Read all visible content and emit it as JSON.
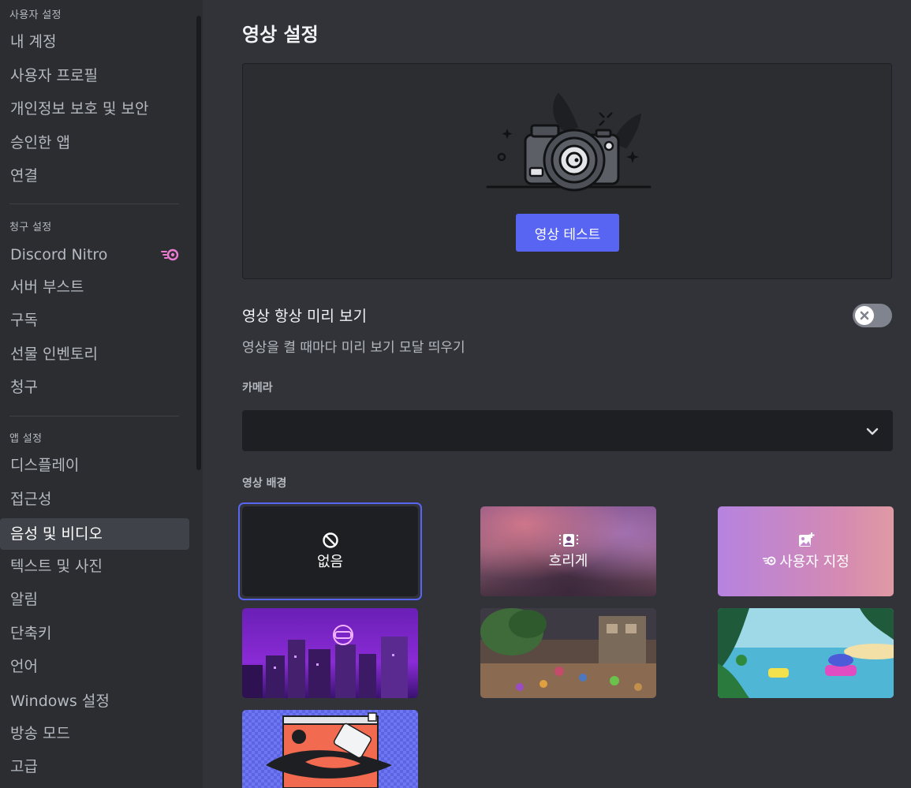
{
  "sidebar": {
    "user_settings_header": "사용자 설정",
    "user_items": [
      "내 계정",
      "사용자 프로필",
      "개인정보 보호 및 보안",
      "승인한 앱",
      "연결"
    ],
    "billing_header": "청구 설정",
    "billing_items": [
      "Discord Nitro",
      "서버 부스트",
      "구독",
      "선물 인벤토리",
      "청구"
    ],
    "app_header": "앱 설정",
    "app_items": [
      "디스플레이",
      "접근성",
      "음성 및 비디오",
      "텍스트 및 사진",
      "알림",
      "단축키",
      "언어",
      "Windows 설정",
      "방송 모드",
      "고급"
    ],
    "active_item": "음성 및 비디오"
  },
  "main": {
    "title": "영상 설정",
    "test_button": "영상 테스트",
    "always_preview": {
      "title": "영상 항상 미리 보기",
      "description": "영상을 켤 때마다 미리 보기 모달 띄우기",
      "enabled": false
    },
    "camera": {
      "label": "카메라",
      "value": ""
    },
    "backgrounds": {
      "label": "영상 배경",
      "options": [
        {
          "label": "없음",
          "icon": "prohibit-icon",
          "selected": true
        },
        {
          "label": "흐리게",
          "icon": "blur-person-icon",
          "selected": false
        },
        {
          "label": "사용자 지정",
          "icon": "add-image-icon",
          "selected": false
        },
        {
          "label": "",
          "icon": "city-night-image",
          "selected": false
        },
        {
          "label": "",
          "icon": "plaza-image",
          "selected": false
        },
        {
          "label": "",
          "icon": "beach-image",
          "selected": false
        },
        {
          "label": "",
          "icon": "retro-window-image",
          "selected": false
        }
      ]
    }
  },
  "colors": {
    "accent": "#5865f2",
    "sidebar_bg": "#2b2d31",
    "main_bg": "#313338",
    "nitro_pink": "#eb7bd0"
  }
}
